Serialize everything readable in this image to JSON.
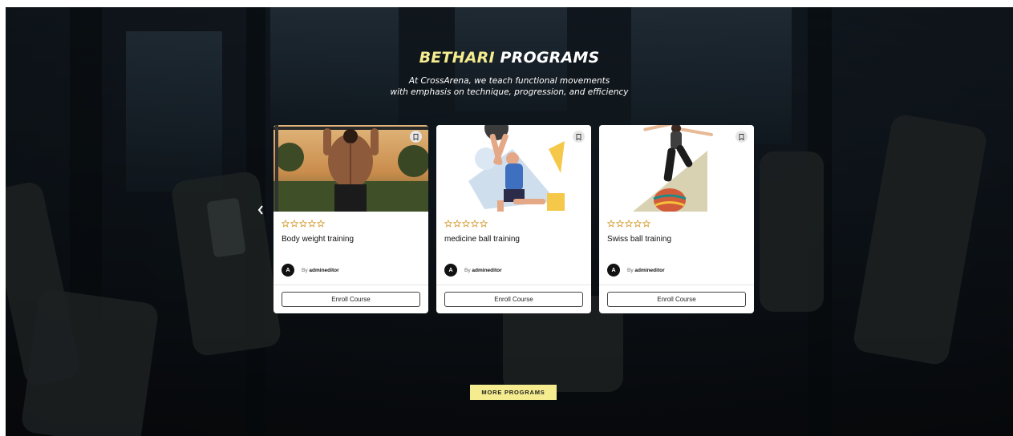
{
  "heading": {
    "accent": "BETHARI",
    "rest": " PROGRAMS"
  },
  "subtitle": {
    "line1": "At CrossArena, we teach functional movements",
    "line2": "with emphasis on technique, progression, and efficiency"
  },
  "colors": {
    "accent": "#f4ec8e",
    "star": "#d9a441"
  },
  "courses": [
    {
      "title": "Body weight training",
      "rating": 0,
      "author_initial": "A",
      "by_label": "By",
      "author": "admineditor",
      "enroll_label": "Enroll Course",
      "image": "man-pull-up-photo"
    },
    {
      "title": "medicine ball training",
      "rating": 0,
      "author_initial": "A",
      "by_label": "By",
      "author": "admineditor",
      "enroll_label": "Enroll Course",
      "image": "medicine-ball-illustration"
    },
    {
      "title": "Swiss ball training",
      "rating": 0,
      "author_initial": "A",
      "by_label": "By",
      "author": "admineditor",
      "enroll_label": "Enroll Course",
      "image": "swiss-ball-illustration"
    }
  ],
  "carousel": {
    "prev_icon": "chevron-left-icon",
    "bookmark_icon": "bookmark-icon",
    "star_icon": "star-outline-icon"
  },
  "more_button": "MORE PROGRAMS"
}
